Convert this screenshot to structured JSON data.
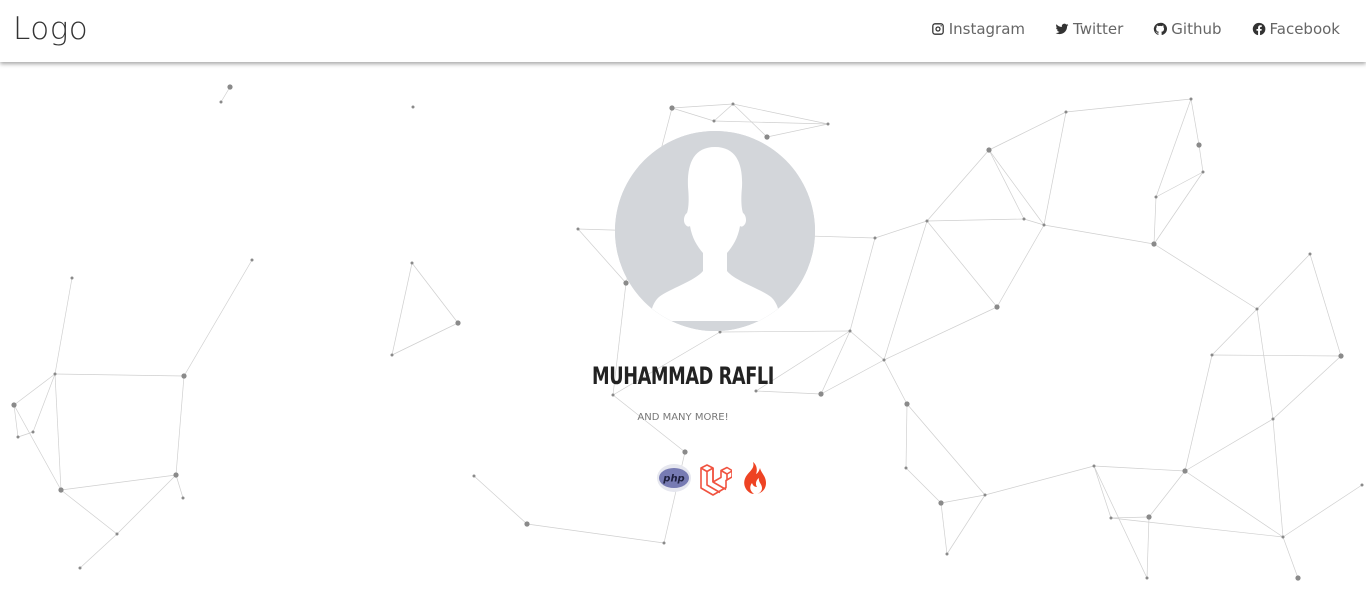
{
  "navbar": {
    "logo": "Logo",
    "links": [
      {
        "label": "Instagram",
        "icon": "instagram-icon"
      },
      {
        "label": "Twitter",
        "icon": "twitter-icon"
      },
      {
        "label": "Github",
        "icon": "github-icon"
      },
      {
        "label": "Facebook",
        "icon": "facebook-icon"
      }
    ]
  },
  "profile": {
    "name": "MUHAMMAD RAFLI",
    "tagline": "AND MANY MORE!",
    "avatar_icon": "default-user-avatar",
    "skills": [
      {
        "label": "php",
        "icon": "php-icon",
        "color": "#777bb3"
      },
      {
        "label": "",
        "icon": "laravel-icon",
        "color": "#f05340"
      },
      {
        "label": "",
        "icon": "codeigniter-icon",
        "color": "#ee4323"
      }
    ]
  },
  "colors": {
    "background": "#ffffff",
    "network_lines": "#c9c9c9",
    "network_nodes": "#888888"
  }
}
